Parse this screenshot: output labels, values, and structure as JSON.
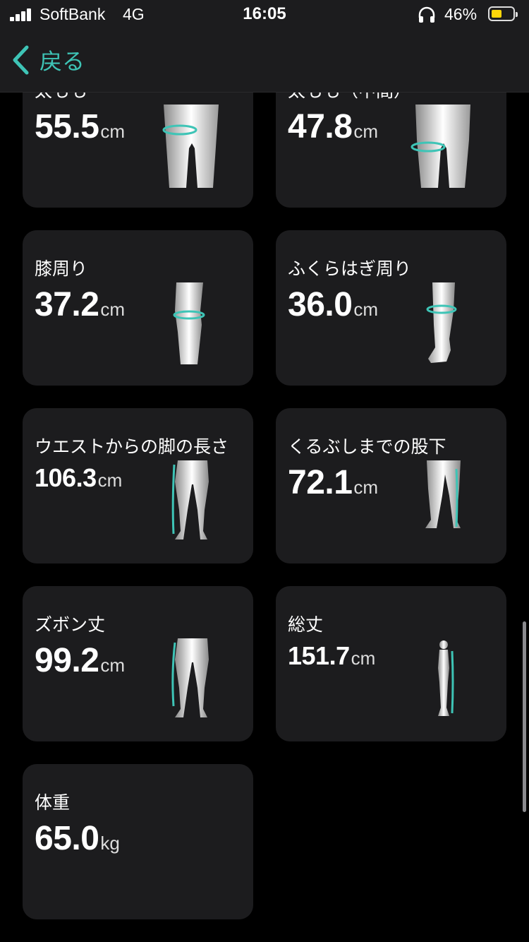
{
  "status_bar": {
    "carrier": "SoftBank",
    "network": "4G",
    "time": "16:05",
    "battery_percent": "46%"
  },
  "nav": {
    "back_label": "戻る"
  },
  "colors": {
    "accent": "#3ec4b6",
    "card_bg": "#1c1c1e",
    "background": "#000000"
  },
  "measurements": [
    {
      "title": "太もも",
      "value": "55.5",
      "unit": "cm",
      "icon": "thigh-icon"
    },
    {
      "title": "太もも（中間）",
      "value": "47.8",
      "unit": "cm",
      "icon": "mid-thigh-icon"
    },
    {
      "title": "膝周り",
      "value": "37.2",
      "unit": "cm",
      "icon": "knee-icon"
    },
    {
      "title": "ふくらはぎ周り",
      "value": "36.0",
      "unit": "cm",
      "icon": "calf-icon"
    },
    {
      "title": "ウエストからの脚の長さ",
      "value": "106.3",
      "unit": "cm",
      "icon": "leg-length-icon"
    },
    {
      "title": "くるぶしまでの股下",
      "value": "72.1",
      "unit": "cm",
      "icon": "inseam-icon"
    },
    {
      "title": "ズボン丈",
      "value": "99.2",
      "unit": "cm",
      "icon": "pants-length-icon"
    },
    {
      "title": "総丈",
      "value": "151.7",
      "unit": "cm",
      "icon": "total-length-icon"
    },
    {
      "title": "体重",
      "value": "65.0",
      "unit": "kg",
      "icon": ""
    }
  ]
}
